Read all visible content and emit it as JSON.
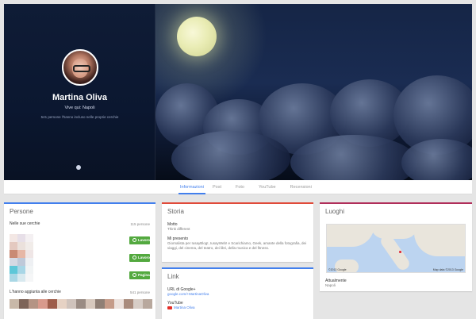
{
  "profile": {
    "name": "Martina Oliva",
    "location": "Vive qui: Napoli",
    "circles_count": "541 persone l'hanno incluso nelle proprie cerchie"
  },
  "tabs": [
    {
      "label": "Informazioni",
      "active": true
    },
    {
      "label": "Post",
      "active": false
    },
    {
      "label": "Foto",
      "active": false
    },
    {
      "label": "YouTube",
      "active": false
    },
    {
      "label": "Recensioni",
      "active": false
    }
  ],
  "persone": {
    "title": "Persone",
    "in_circles_label": "Nelle sue cerchie",
    "in_circles_count": "115 persone",
    "buttons": [
      "Lavoro",
      "Lavoro",
      "Pagina"
    ],
    "added_label": "L'hanno aggiunta alle cerchie",
    "added_count": "541 persone"
  },
  "storia": {
    "title": "Storia",
    "motto_label": "Motto",
    "motto_value": "Think different",
    "about_label": "Mi presento",
    "about_value": "Giornalista per IusayBlog!, IusayWeb! e Scarichiamo, Geek, amante della fotografia, dei viaggi, del cinema, del teatro, dei libri, della musica e del fitness."
  },
  "links": {
    "title": "Link",
    "gplus_label": "URL di Google+",
    "gplus_url": "google.com/+MartinaOliva",
    "youtube_label": "YouTube",
    "youtube_value": "Martina Oliva"
  },
  "luoghi": {
    "title": "Luoghi",
    "map_caption_left": "©2013 Google",
    "map_caption_right": "Map data ©2013 Google",
    "current_label": "Attualmente",
    "current_value": "Napoli"
  },
  "colors": {
    "accent_blue": "#427fed",
    "storia_red": "#e04a39",
    "luoghi_magenta": "#b02e5a",
    "add_green": "#53a93f"
  }
}
